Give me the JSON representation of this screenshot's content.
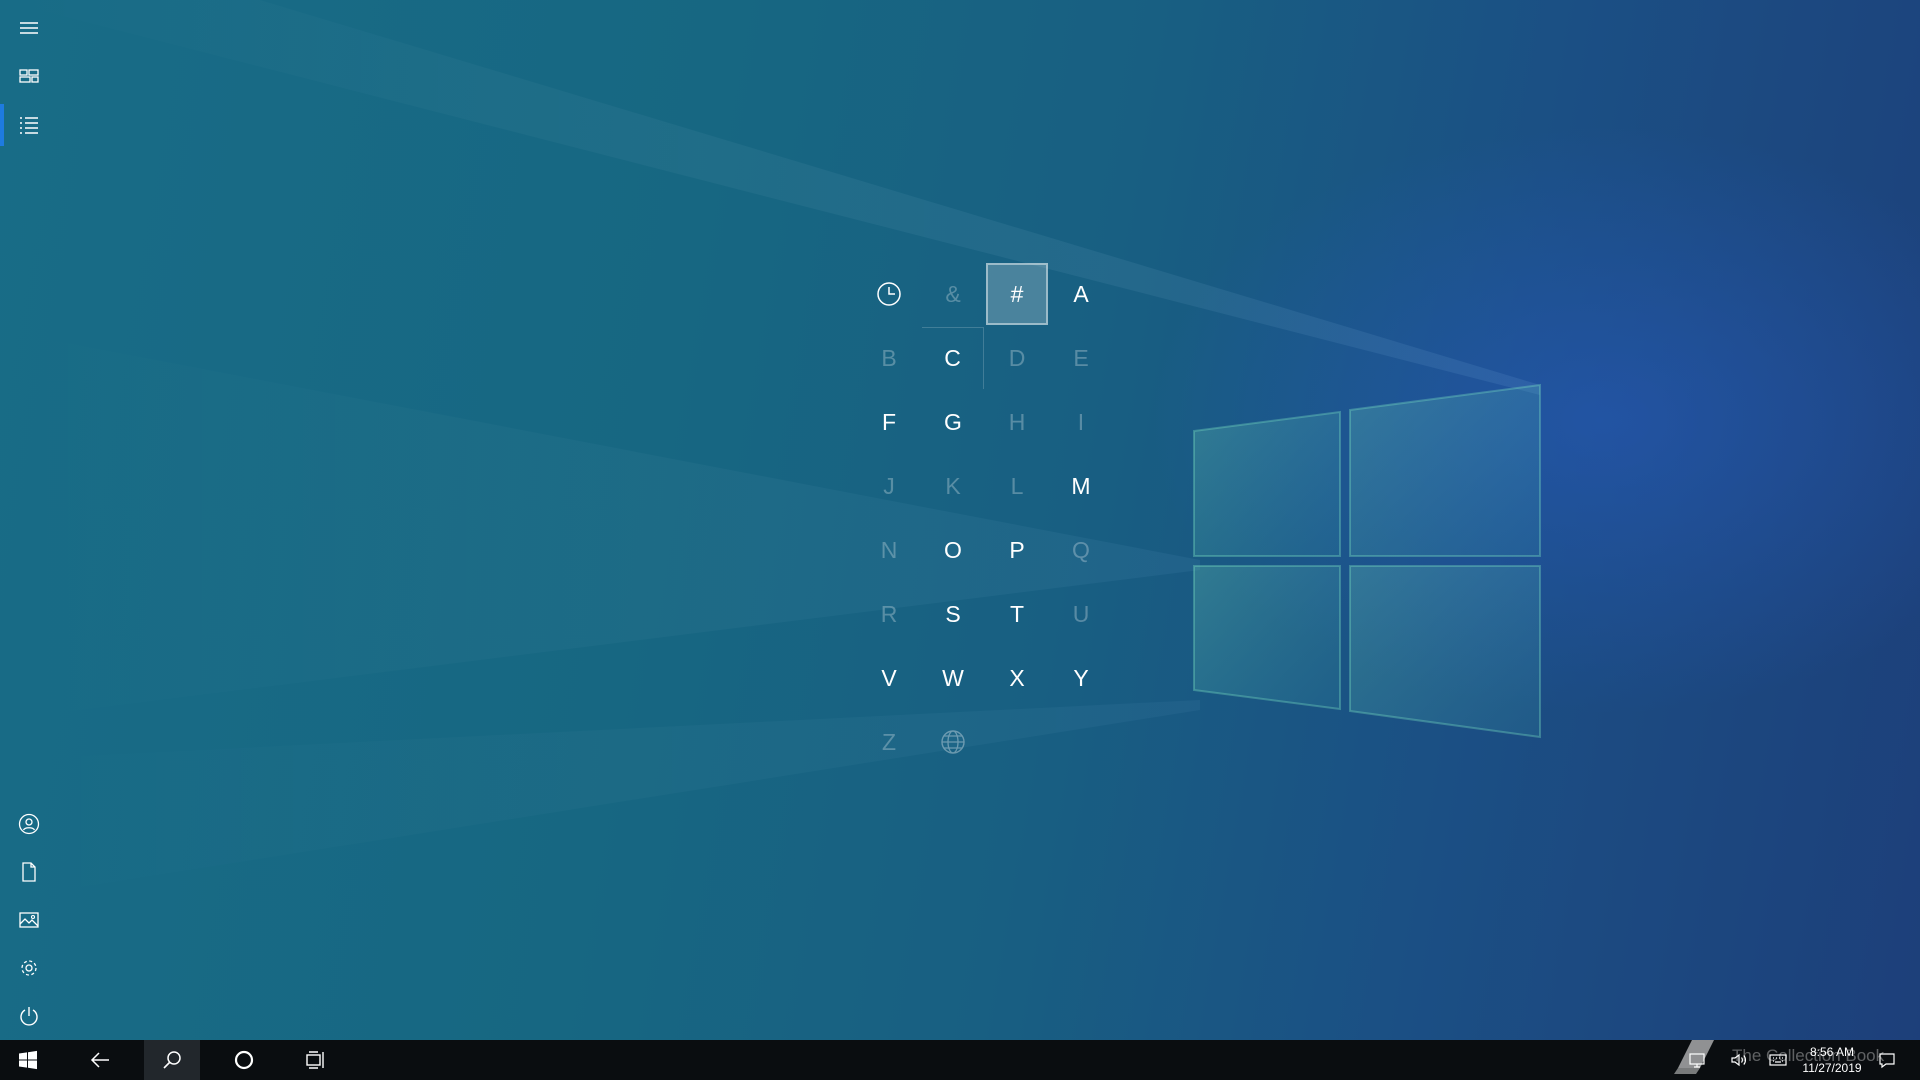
{
  "left_rail": {
    "items": [
      {
        "icon": "hamburger-menu-icon"
      },
      {
        "icon": "tiles-view-icon"
      },
      {
        "icon": "all-apps-list-icon",
        "selected": true
      },
      {
        "icon": "user-account-icon"
      },
      {
        "icon": "documents-icon"
      },
      {
        "icon": "pictures-icon"
      },
      {
        "icon": "settings-gear-icon"
      },
      {
        "icon": "power-icon"
      }
    ],
    "accent_color": "#1e7be0"
  },
  "jump_list": {
    "cells": [
      {
        "label": "",
        "icon": "recent-clock-icon",
        "enabled": true
      },
      {
        "label": "&",
        "enabled": false
      },
      {
        "label": "#",
        "enabled": true,
        "selected": true
      },
      {
        "label": "A",
        "enabled": true
      },
      {
        "label": "B",
        "enabled": false
      },
      {
        "label": "C",
        "enabled": true
      },
      {
        "label": "D",
        "enabled": false
      },
      {
        "label": "E",
        "enabled": false
      },
      {
        "label": "F",
        "enabled": true
      },
      {
        "label": "G",
        "enabled": true
      },
      {
        "label": "H",
        "enabled": false
      },
      {
        "label": "I",
        "enabled": false
      },
      {
        "label": "J",
        "enabled": false
      },
      {
        "label": "K",
        "enabled": false
      },
      {
        "label": "L",
        "enabled": false
      },
      {
        "label": "M",
        "enabled": true
      },
      {
        "label": "N",
        "enabled": false
      },
      {
        "label": "O",
        "enabled": true
      },
      {
        "label": "P",
        "enabled": true
      },
      {
        "label": "Q",
        "enabled": false
      },
      {
        "label": "R",
        "enabled": false
      },
      {
        "label": "S",
        "enabled": true
      },
      {
        "label": "T",
        "enabled": true
      },
      {
        "label": "U",
        "enabled": false
      },
      {
        "label": "V",
        "enabled": true
      },
      {
        "label": "W",
        "enabled": true
      },
      {
        "label": "X",
        "enabled": true
      },
      {
        "label": "Y",
        "enabled": true
      },
      {
        "label": "Z",
        "enabled": false
      },
      {
        "label": "",
        "icon": "globe-icon",
        "enabled": false
      }
    ]
  },
  "taskbar": {
    "buttons": [
      {
        "icon": "windows-start-icon"
      },
      {
        "icon": "back-arrow-icon"
      },
      {
        "icon": "search-icon",
        "active": true
      },
      {
        "icon": "cortana-circle-icon"
      },
      {
        "icon": "task-view-icon"
      }
    ],
    "tray": [
      {
        "icon": "network-icon"
      },
      {
        "icon": "volume-icon"
      },
      {
        "icon": "touch-keyboard-icon"
      },
      {
        "icon": "action-center-icon"
      }
    ],
    "clock": {
      "time": "8:56 AM",
      "date": "11/27/2019"
    }
  },
  "watermark": {
    "text": "The Collection Book"
  }
}
